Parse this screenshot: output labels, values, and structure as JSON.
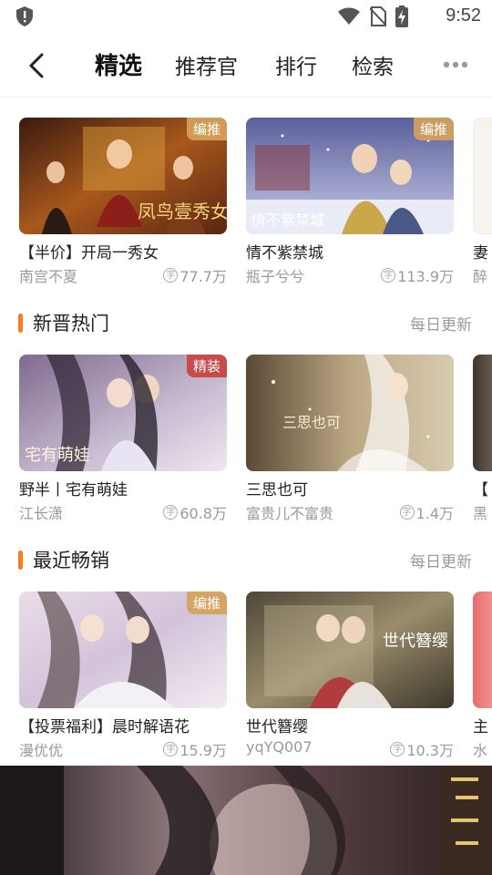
{
  "status_bar": {
    "time": "9:52"
  },
  "header": {
    "tabs": [
      "精选",
      "推荐官",
      "排行",
      "检索"
    ],
    "active_tab": "精选"
  },
  "featured": [
    {
      "title": "【半价】开局一秀女",
      "author": "南宫不夏",
      "count": "77.7万",
      "badge": "编推"
    },
    {
      "title": "情不紫禁城",
      "author": "瓶子兮兮",
      "count": "113.9万",
      "badge": "编推"
    },
    {
      "title": "妻",
      "author": "醉"
    }
  ],
  "sections": [
    {
      "title": "新晋热门",
      "update_label": "每日更新",
      "items": [
        {
          "title": "野半丨宅有萌娃",
          "author": "江长潇",
          "count": "60.8万",
          "badge": "精装"
        },
        {
          "title": "三思也可",
          "author": "富贵儿不富贵",
          "count": "1.4万"
        },
        {
          "title": "【",
          "author": "黑"
        }
      ]
    },
    {
      "title": "最近畅销",
      "update_label": "每日更新",
      "items": [
        {
          "title": "【投票福利】晨时解语花",
          "author": "漫优优",
          "count": "15.9万",
          "badge": "编推"
        },
        {
          "title": "世代簪缨",
          "author": "yqYQ007",
          "count": "10.3万"
        },
        {
          "title": "主",
          "author": "水"
        }
      ]
    }
  ],
  "cover_overlay_texts": [
    "凤鸟壹秀女",
    "情不紫禁城",
    "宅有萌娃",
    "三思也可",
    "世代簪缨"
  ],
  "colors": {
    "accent": "#ff7a1a",
    "badge_gold": "#d6a25a",
    "badge_red": "#c94a4a"
  }
}
